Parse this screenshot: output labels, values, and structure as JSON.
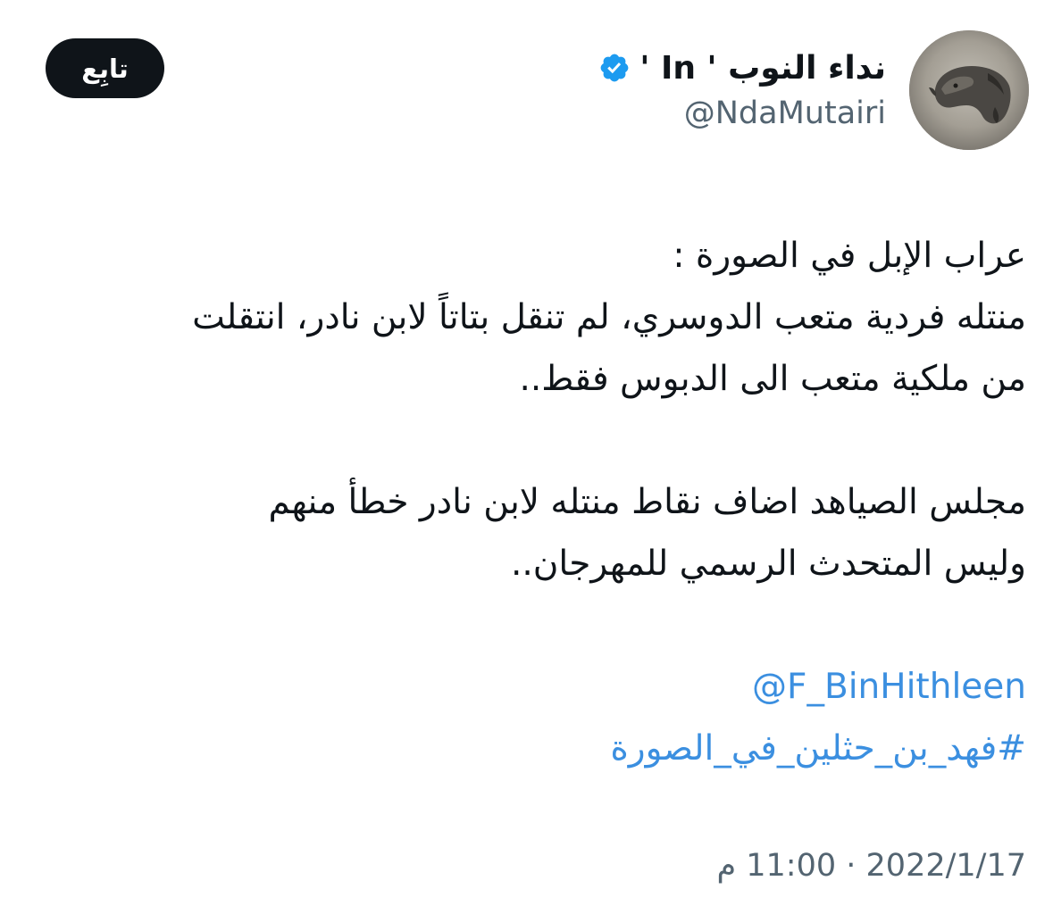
{
  "author": {
    "display_name": "نداء النوب",
    "name_suffix": "' In '",
    "handle": "@NdaMutairi",
    "verified_icon": "verified-badge-icon",
    "avatar_icon": "camel-avatar"
  },
  "follow_button": {
    "label": "تابِع"
  },
  "tweet": {
    "lines": [
      "عراب الإبل في الصورة :",
      "منتله فردية متعب الدوسري، لم تنقل بتاتاً لابن نادر، انتقلت",
      "من ملكية متعب الى الدبوس فقط..",
      "",
      "مجلس الصياهد اضاف نقاط منتله لابن نادر خطأ منهم",
      "وليس المتحدث الرسمي للمهرجان.."
    ],
    "mention": "@F_BinHithleen",
    "hashtag": "#فهد_بن_حثلين_في_الصورة"
  },
  "timestamp": {
    "text": "2022/1/17 · 11:00 م",
    "date": "2022/1/17",
    "time": "11:00 م"
  },
  "colors": {
    "text": "#0f1419",
    "secondary": "#536471",
    "link": "#3b8fe0",
    "verified": "#1d9bf0",
    "button_bg": "#0f1419"
  }
}
